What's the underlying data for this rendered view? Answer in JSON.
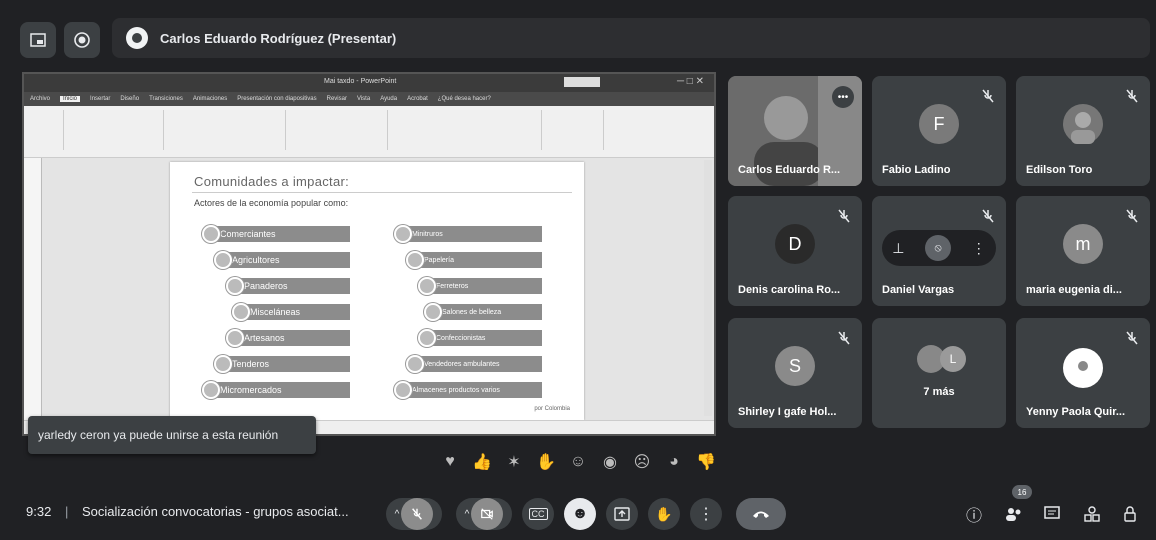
{
  "presenter": {
    "title": "Carlos Eduardo Rodríguez (Presentar)"
  },
  "slide": {
    "heading": "Comunidades a impactar:",
    "subtitle": "Actores de la economía popular como:",
    "left_items": [
      "Comerciantes",
      "Agricultores",
      "Panaderos",
      "Misceláneas",
      "Artesanos",
      "Tenderos",
      "Micromercados"
    ],
    "right_items": [
      "Minitruros",
      "Papelería",
      "Ferreteros",
      "Salones de belleza",
      "Confeccionistas",
      "Vendedores ambulantes",
      "Almacenes productos varios"
    ],
    "credit": "por Colombia"
  },
  "ppt": {
    "window_title": "Mai taxdo - PowerPoint",
    "tabs": [
      "Archivo",
      "Inicio",
      "Insertar",
      "Diseño",
      "Transiciones",
      "Animaciones",
      "Presentación con diapositivas",
      "Revisar",
      "Vista",
      "Ayuda",
      "Acrobat",
      "¿Qué desea hacer?"
    ]
  },
  "toast": {
    "text": "yarledy ceron ya puede unirse a esta reunión"
  },
  "participants": [
    {
      "name": "Carlos Eduardo R...",
      "type": "video"
    },
    {
      "name": "Fabio Ladino",
      "letter": "F"
    },
    {
      "name": "Edilson Toro",
      "type": "photo"
    },
    {
      "name": "Denis carolina Ro...",
      "letter": "D"
    },
    {
      "name": "Daniel Vargas",
      "type": "hover"
    },
    {
      "name": "maria eugenia di...",
      "letter": "m"
    },
    {
      "name": "Shirley I gafe Hol...",
      "letter": "S"
    },
    {
      "name": "7 más",
      "type": "more"
    },
    {
      "name": "Yenny Paola Quir...",
      "type": "logo"
    }
  ],
  "more_avatar_letter": "L",
  "bottom": {
    "time": "9:32",
    "separator": "|",
    "meeting_title": "Socialización convocatorias - grupos asociat...",
    "participants_count": "16"
  }
}
